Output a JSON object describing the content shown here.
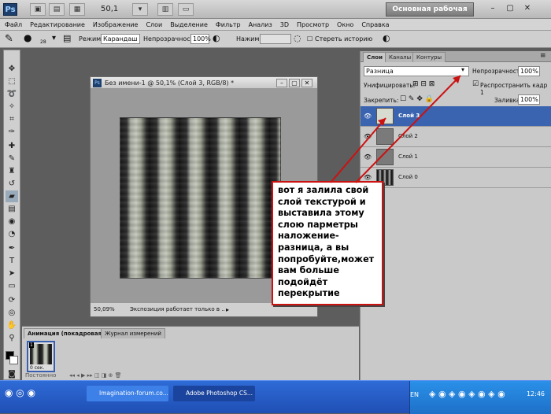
{
  "appbar": {
    "ps_icon": "Ps",
    "zoom_value": "50,1",
    "workspace_label": "Основная рабочая среда",
    "minimize_label": "–",
    "maximize_label": "▢",
    "close_label": "✕"
  },
  "menu": [
    "Файл",
    "Редактирование",
    "Изображение",
    "Слои",
    "Выделение",
    "Фильтр",
    "Анализ",
    "3D",
    "Просмотр",
    "Окно",
    "Справка"
  ],
  "options": {
    "brush_size": "28",
    "mode_label": "Режим:",
    "mode_value": "Карандаш",
    "opacity_label": "Непрозрачность:",
    "opacity_value": "100%",
    "pressure_label": "Нажим:",
    "erase_history_label": "Стереть историю"
  },
  "document": {
    "title": "Без имени-1 @ 50,1% (Слой 3, RGB/8) *",
    "zoom": "50,09%",
    "status": "Экспозиция работает только в ..."
  },
  "layers_panel": {
    "tabs": [
      "Слои",
      "Каналы",
      "Контуры"
    ],
    "blend_mode": "Разница",
    "opacity_label": "Непрозрачность:",
    "opacity_value": "100%",
    "unify_label": "Унифицировать:",
    "propagate_label": "Распространить кадр 1",
    "lock_label": "Закрепить:",
    "fill_label": "Заливка:",
    "fill_value": "100%",
    "layers": [
      {
        "name": "Слой 3",
        "selected": true
      },
      {
        "name": "Слой 2",
        "selected": false
      },
      {
        "name": "Слой 1",
        "selected": false
      },
      {
        "name": "Слой 0",
        "selected": false
      }
    ]
  },
  "annotation": {
    "text": "вот я залила свой слой текстурой и выставила этому слою парметры наложение-разница, а вы попробуйте,может вам больше подойдёт перекрытие",
    "border_color": "#cc1111"
  },
  "animation_panel": {
    "tabs": [
      "Анимация (покадровая)",
      "Журнал измерений"
    ],
    "frame_number": "1",
    "frame_delay": "0 сек.",
    "loop_label": "Постоянно"
  },
  "taskbar": {
    "items": [
      "Imagination-forum.co...",
      "Adobe Photoshop CS..."
    ],
    "lang": "EN",
    "clock": "12:46"
  }
}
